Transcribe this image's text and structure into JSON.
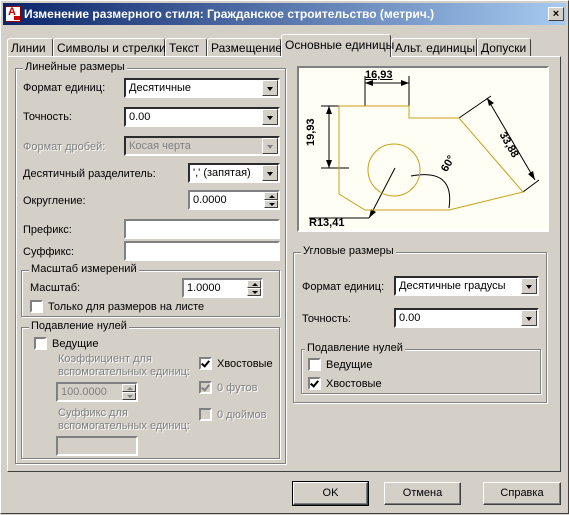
{
  "window": {
    "title": "Изменение размерного стиля: Гражданское строительство (метрич.)",
    "close_glyph": "×"
  },
  "tabs": [
    {
      "label": "Линии"
    },
    {
      "label": "Символы и стрелки"
    },
    {
      "label": "Текст"
    },
    {
      "label": "Размещение"
    },
    {
      "label": "Основные единицы",
      "active": true
    },
    {
      "label": "Альт. единицы"
    },
    {
      "label": "Допуски"
    }
  ],
  "linear": {
    "title": "Линейные размеры",
    "unit_format_label": "Формат единиц:",
    "unit_format_value": "Десятичные",
    "precision_label": "Точность:",
    "precision_value": "0.00",
    "fraction_format_label": "Формат дробей:",
    "fraction_format_value": "Косая черта",
    "decimal_sep_label": "Десятичный  разделитель:",
    "decimal_sep_value": "',' (запятая)",
    "round_label": "Округление:",
    "round_value": "0.0000",
    "prefix_label": "Префикс:",
    "prefix_value": "",
    "suffix_label": "Суффикс:",
    "suffix_value": ""
  },
  "scale": {
    "title": "Масштаб измерений",
    "scale_label": "Масштаб:",
    "scale_value": "1.0000",
    "layout_only_label": "Только для размеров на листе",
    "layout_only_checked": false
  },
  "zero_suppress_linear": {
    "title": "Подавление нулей",
    "leading_label": "Ведущие",
    "leading_checked": false,
    "subunit_factor_label_1": "Коэффициент для",
    "subunit_factor_label_2": "вспомогательных единиц:",
    "subunit_factor_value": "100.0000",
    "subunit_suffix_label_1": "Суффикс для",
    "subunit_suffix_label_2": "вспомогательных единиц:",
    "subunit_suffix_value": "",
    "trailing_label": "Хвостовые",
    "trailing_checked": true,
    "feet_label": "0 футов",
    "feet_checked": true,
    "inches_label": "0 дюймов",
    "inches_checked": false
  },
  "preview": {
    "dim_top": "16,93",
    "dim_left": "19,93",
    "dim_right": "33,88",
    "dim_angle": "60°",
    "dim_radius": "R13,41",
    "line_color": "#c8a018"
  },
  "angular": {
    "title": "Угловые размеры",
    "unit_format_label": "Формат единиц:",
    "unit_format_value": "Десятичные градусы",
    "precision_label": "Точность:",
    "precision_value": "0.00"
  },
  "zero_suppress_angular": {
    "title": "Подавление нулей",
    "leading_label": "Ведущие",
    "leading_checked": false,
    "trailing_label": "Хвостовые",
    "trailing_checked": true
  },
  "buttons": {
    "ok": "OK",
    "cancel": "Отмена",
    "help": "Справка"
  }
}
